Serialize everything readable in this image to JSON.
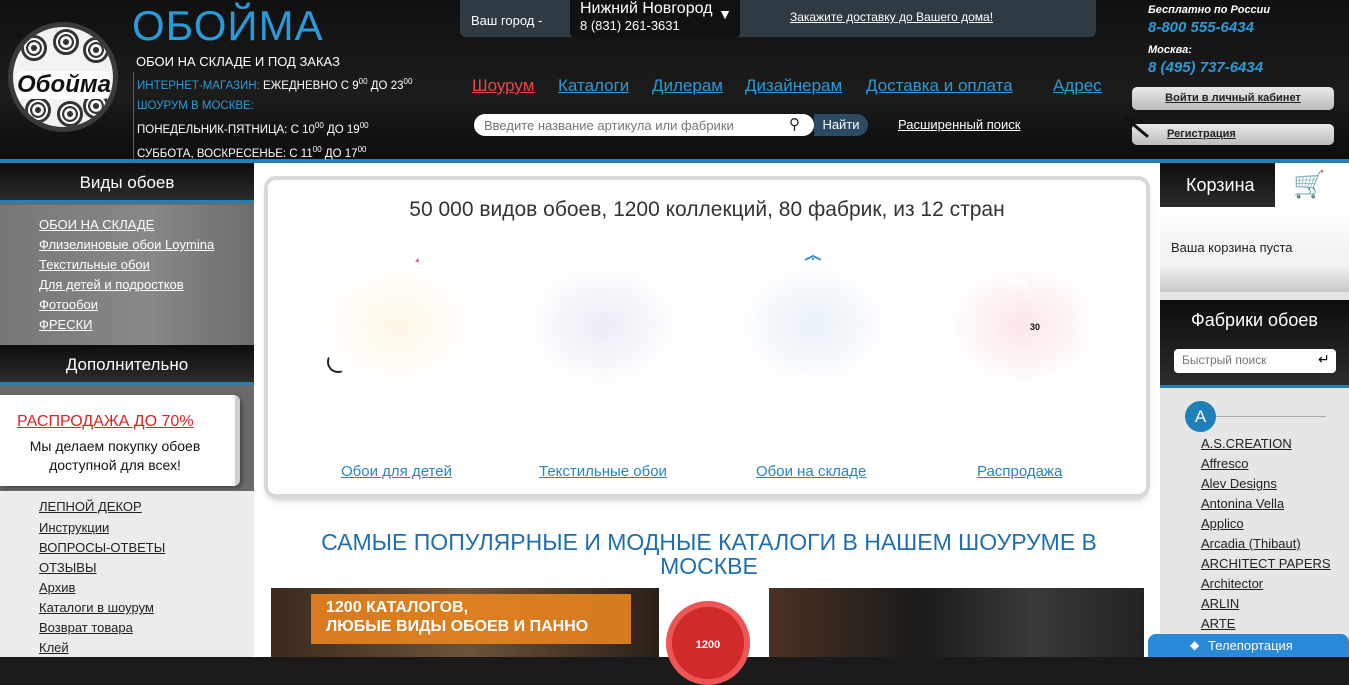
{
  "header": {
    "brand": "ОБОЙМА",
    "logo_text": "Обойма",
    "tagline": "ОБОИ НА СКЛАДЕ И ПОД ЗАКАЗ",
    "hours": {
      "shop_label": "ИНТЕРНЕТ-МАГАЗИН:",
      "shop_hours": "ЕЖЕДНЕВНО С 9",
      "shop_sup1": "00",
      "shop_to": " ДО 23",
      "shop_sup2": "00",
      "showroom_label": "ШОУРУМ В МОСКВЕ:",
      "weekdays": "ПОНЕДЕЛЬНИК-ПЯТНИЦА: С 10",
      "weekdays_sup1": "00",
      "weekdays_to": " ДО 19",
      "weekdays_sup2": "00",
      "weekend": "СУББОТА, ВОСКРЕСЕНЬЕ: С 11",
      "weekend_sup1": "00",
      "weekend_to": " ДО 17",
      "weekend_sup2": "00"
    },
    "city_label": "Ваш город -",
    "city_name": "Нижний Новгород",
    "city_phone": "8 (831) 261-3631",
    "delivery_link": "Закажите доставку до Вашего дома!",
    "nav": [
      "Шоурум",
      "Каталоги",
      "Дилерам",
      "Дизайнерам",
      "Доставка и оплата",
      "Адрес"
    ],
    "search_placeholder": "Введите название артикула или фабрики",
    "search_button": "Найти",
    "advanced_search": "Расширенный поиск",
    "free_label": "Бесплатно по России",
    "free_phone": "8-800 555-6434",
    "moscow_label": "Москва:",
    "moscow_phone": "8 (495) 737-6434",
    "login": "Войти в личный кабинет",
    "register": "Регистрация"
  },
  "left": {
    "types_title": "Виды обоев",
    "types": [
      "ОБОИ НА СКЛАДЕ",
      "Флизелиновые обои Loymina",
      "Текстильные обои",
      "Для детей и подростков",
      "Фотообои",
      "ФРЕСКИ"
    ],
    "extra_title": "Дополнительно",
    "sale_title": "РАСПРОДАЖА ДО 70%",
    "sale_text_1": "Мы делаем покупку обоев",
    "sale_text_2": "доступной для всех!",
    "extra": [
      "ЛЕПНОЙ ДЕКОР",
      "Инструкции",
      "ВОПРОСЫ-ОТВЕТЫ",
      "ОТЗЫВЫ",
      "Архив",
      "Каталоги в шоурум",
      "Возврат товара",
      "Клей"
    ]
  },
  "main": {
    "panel_title": "50 000 видов обоев, 1200 коллекций, 80 фабрик, из 12 стран",
    "categories": [
      "Обои для детей",
      "Текстильные обои",
      "Обои на складе",
      "Распродажа"
    ],
    "sale_badges": [
      "50%",
      "30"
    ],
    "heading": "САМЫЕ ПОПУЛЯРНЫЕ И МОДНЫЕ КАТАЛОГИ В НАШЕМ ШОУРУМЕ В МОСКВЕ",
    "banner_line1": "1200 КАТАЛОГОВ,",
    "banner_line2": "ЛЮБЫЕ ВИДЫ ОБОЕВ И ПАННО",
    "badge_num": "1200"
  },
  "right": {
    "cart_title": "Корзина",
    "cart_empty": "Ваша корзина пуста",
    "factories_title": "Фабрики обоев",
    "quick_search_placeholder": "Быстрый поиск",
    "letter": "A",
    "factories": [
      "A.S.CREATION",
      "Affresco",
      "Alev Designs",
      "Antonina Vella",
      "Applico",
      "Arcadia (Thibaut)",
      "ARCHITECT PAPERS",
      "Architector",
      "ARLIN",
      "ARTE"
    ]
  },
  "teleport": "Телепортация",
  "colors": {
    "accent": "#2a9ad9",
    "sale_red": "#d22222",
    "header_bg": "#151515"
  }
}
